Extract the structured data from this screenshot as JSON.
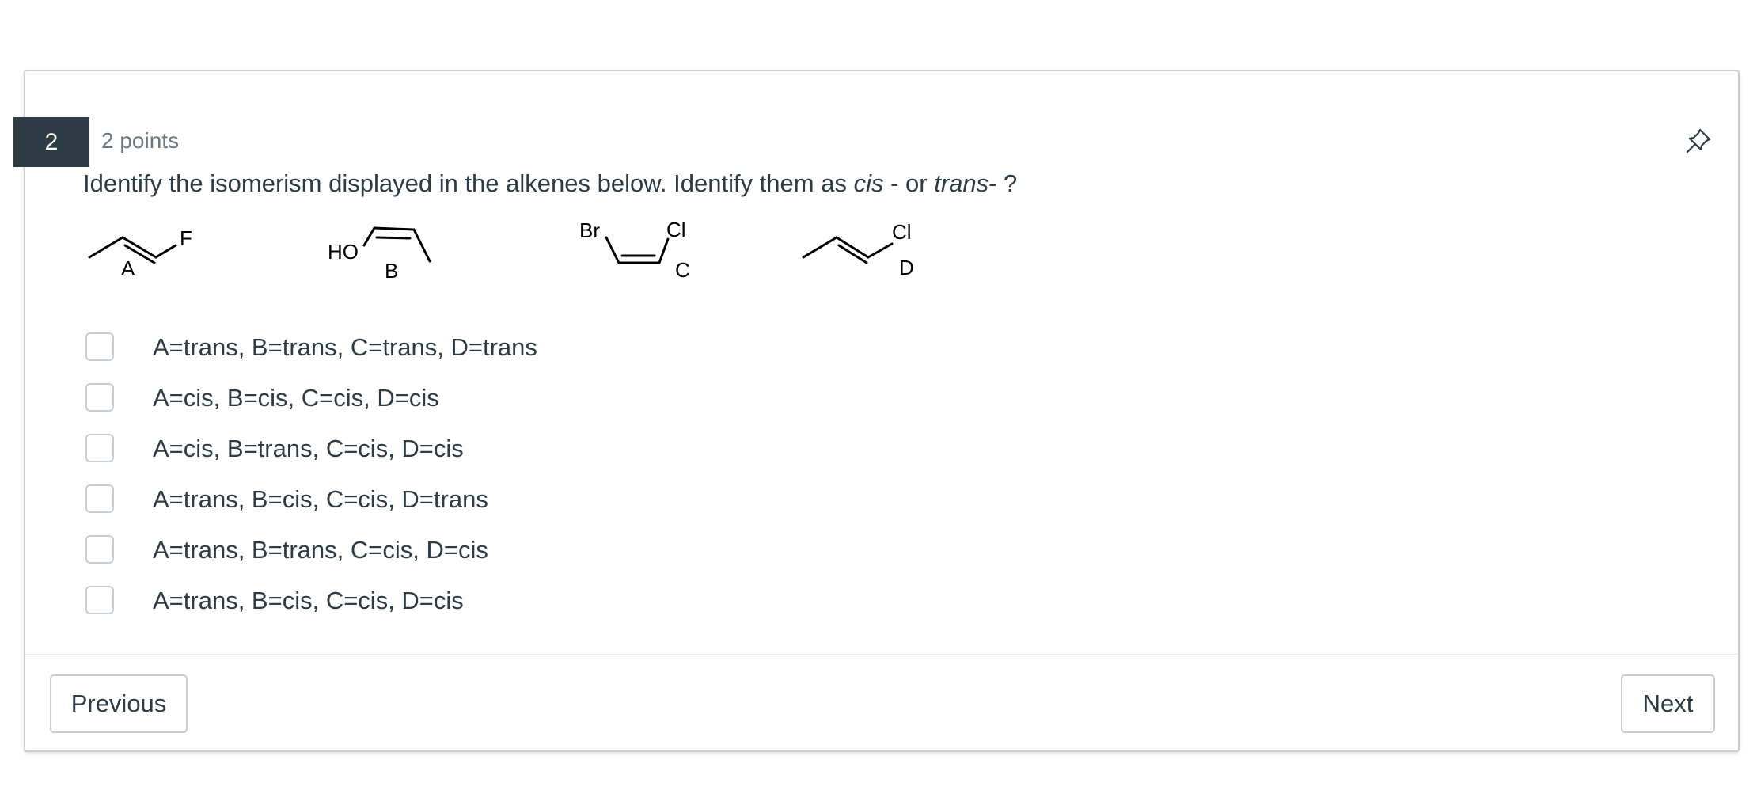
{
  "question": {
    "number": "2",
    "points": "2 points",
    "text_before": "Identify the isomerism displayed in the alkenes below. Identify them as ",
    "cis": "cis",
    "text_middle": " - or ",
    "trans": "trans",
    "text_after": "- ?"
  },
  "structures": {
    "A": {
      "substituent": "F",
      "label": "A"
    },
    "B": {
      "substituent": "HO",
      "label": "B"
    },
    "C": {
      "substituent_left": "Br",
      "substituent_right": "Cl",
      "label": "C"
    },
    "D": {
      "substituent": "Cl",
      "label": "D"
    }
  },
  "answers": [
    {
      "label": "A=trans, B=trans, C=trans, D=trans",
      "checked": false
    },
    {
      "label": "A=cis, B=cis, C=cis, D=cis",
      "checked": false
    },
    {
      "label": "A=cis, B=trans, C=cis, D=cis",
      "checked": false
    },
    {
      "label": "A=trans, B=cis, C=cis, D=trans",
      "checked": false
    },
    {
      "label": "A=trans, B=trans, C=cis, D=cis",
      "checked": false
    },
    {
      "label": "A=trans, B=cis, C=cis, D=cis",
      "checked": false
    }
  ],
  "footer": {
    "previous_label": "Previous",
    "next_label": "Next"
  },
  "icons": {
    "pin": "pin-icon"
  },
  "colors": {
    "number_badge_bg": "#2d3b45",
    "text": "#2d3b45",
    "muted": "#6b7780",
    "border": "#c7cdd1"
  }
}
